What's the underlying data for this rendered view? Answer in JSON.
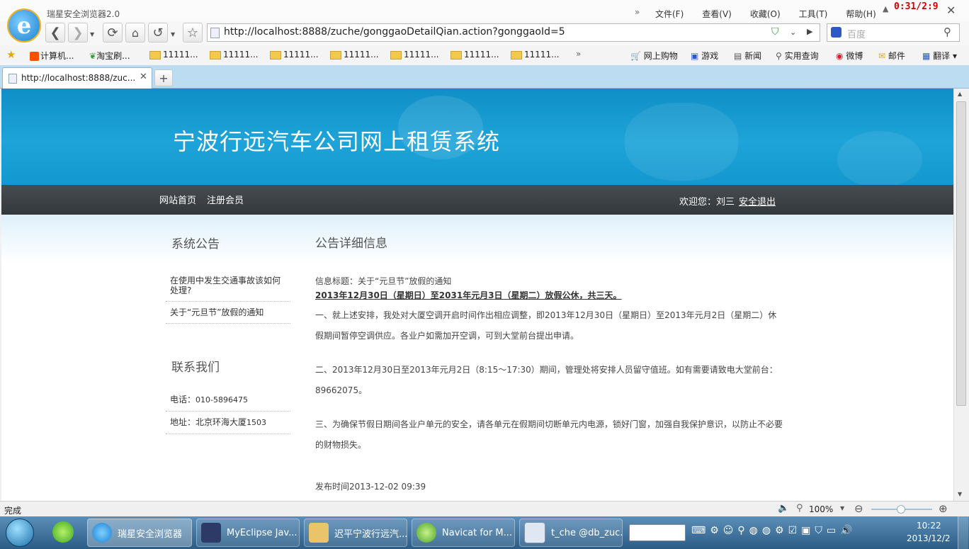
{
  "browser": {
    "title": "瑞星安全浏览器2.0",
    "timer_overlay": "0:31/2:9",
    "menu": [
      "文件(F)",
      "查看(V)",
      "收藏(O)",
      "工具(T)",
      "帮助(H)"
    ],
    "address": "http://localhost:8888/zuche/gonggaoDetailQian.action?gonggaoId=5",
    "search_placeholder": "百度",
    "favorites_left": [
      "计算机...",
      "淘宝刷...",
      "11111...",
      "11111...",
      "11111...",
      "11111...",
      "11111...",
      "11111...",
      "11111..."
    ],
    "favorites_more": "»",
    "favorites_right": [
      "网上购物",
      "游戏",
      "新闻",
      "实用查询",
      "微博",
      "邮件",
      "翻译"
    ],
    "tab_title": "http://localhost:8888/zuc...",
    "status": "完成",
    "zoom": "100%"
  },
  "site": {
    "banner_title": "宁波行远汽车公司网上租赁系统",
    "nav": [
      "网站首页",
      "注册会员"
    ],
    "welcome": "欢迎您：刘三",
    "logout": "安全退出",
    "sidebar": {
      "notice_heading": "系统公告",
      "notices": [
        "在使用中发生交通事故该如何处理?",
        "关于“元旦节”放假的通知"
      ],
      "contact_heading": "联系我们",
      "phone_label": "电话：",
      "phone": "010-5896475",
      "address_label": "地址：",
      "address_value": "北京环海大厦",
      "address_num": "1503"
    },
    "detail": {
      "heading": "公告详细信息",
      "title_line": "信息标题：关于“元旦节”放假的通知",
      "bold_line": "2013年12月30日（星期日）至2031年元月3日（星期二）放假公休，共三天。",
      "p1": "一、就上述安排，我处对大厦空调开启时间作出相应调整，即2013年12月30日（星期日）至2013年元月2日（星期二）休假期间暂停空调供应。各业户如需加开空调，可到大堂前台提出申请。",
      "p2": "二、2013年12月30日至2013年元月2日（8:15～17:30）期间，管理处将安排人员留守值班。如有需要请致电大堂前台：89662075。",
      "p3": "三、为确保节假日期间各业户单元的安全，请各单元在假期间切断单元内电源，锁好门窗，加强自我保护意识，以防止不必要的财物损失。",
      "publish": "发布时间2013-12-02 09:39"
    }
  },
  "taskbar": {
    "items": [
      "瑞星安全浏览器",
      "MyEclipse Jav...",
      "迟平宁波行远汽...",
      "Navicat for M...",
      "t_che @db_zuc..."
    ],
    "time": "10:22",
    "date": "2013/12/2"
  },
  "colors": {
    "banner": "#1c9dd0",
    "navbar": "#3a3f43",
    "tabbar": "#bcdcf2"
  }
}
